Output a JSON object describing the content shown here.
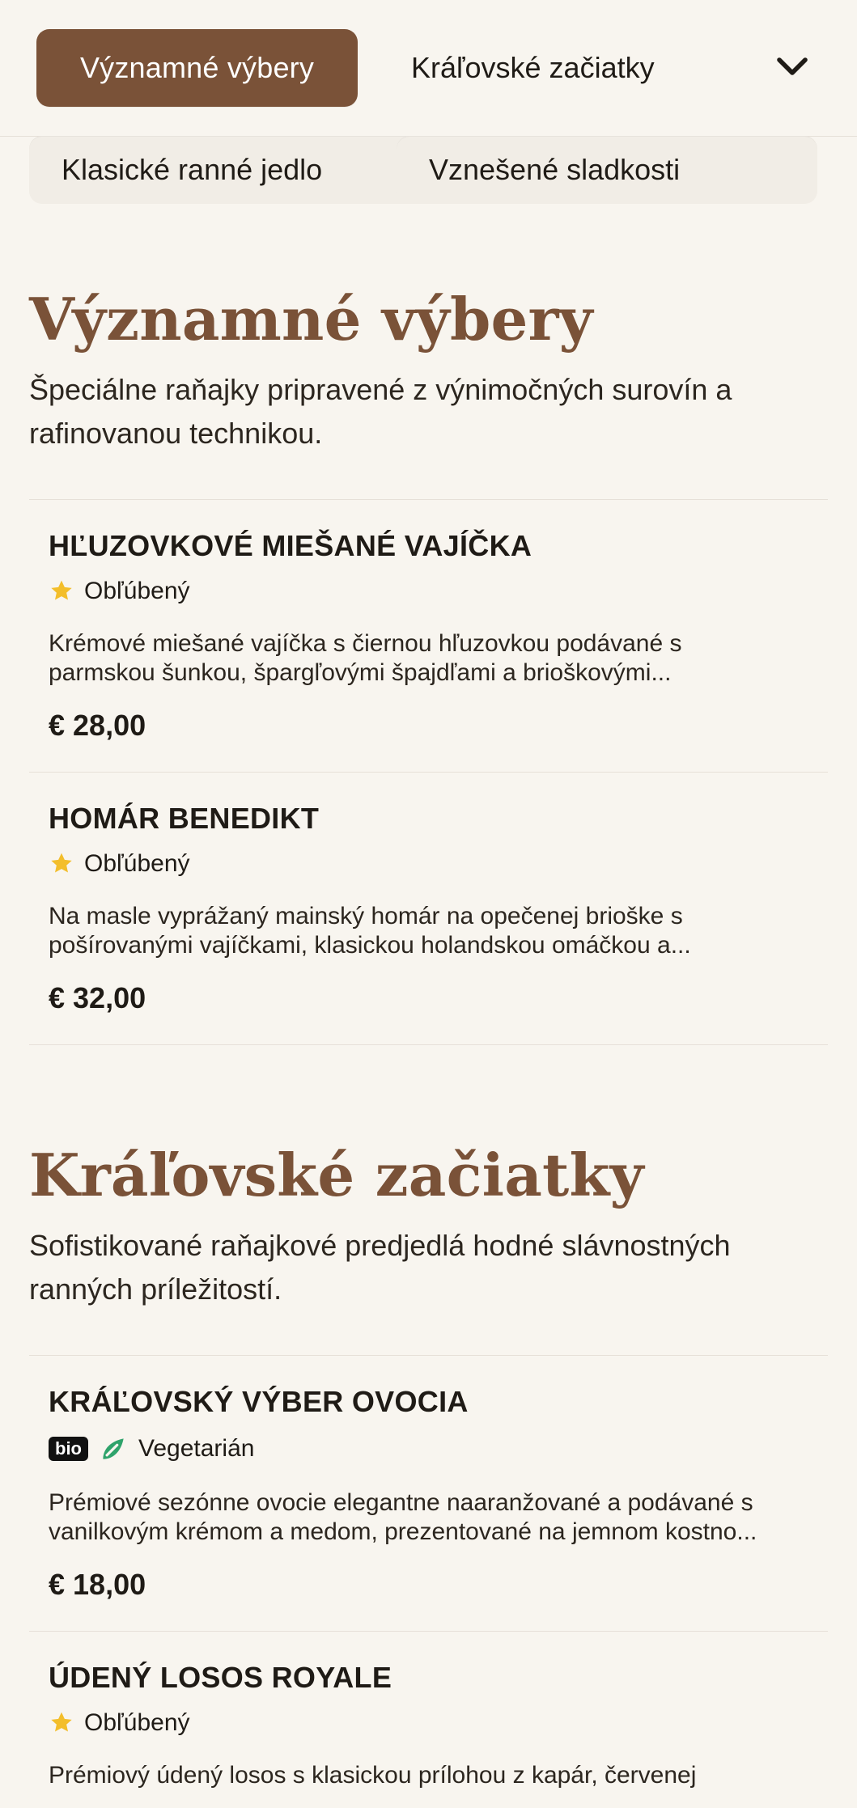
{
  "nav": {
    "active_tab": "Významné výbery",
    "second_tab": "Kráľovské začiatky",
    "chips": [
      "Klasické ranné jedlo",
      "Vznešené sladkosti"
    ],
    "dropdown_icon": "chevron-down-icon"
  },
  "sections": [
    {
      "title": "Významné výbery",
      "description": "Špeciálne raňajky pripravené z výnimočných surovín a rafinovanou technikou.",
      "items": [
        {
          "name": "HĽUZOVKOVÉ MIEŠANÉ VAJÍČKA",
          "badge": "Obľúbený",
          "desc_lines": [
            "Krémové miešané vajíčka s čiernou hľuzovkou podávané s",
            "parmskou šunkou, špargľovými špajdľami a brioškovými..."
          ],
          "price": "€ 28,00"
        },
        {
          "name": "HOMÁR BENEDIKT",
          "badge": "Obľúbený",
          "desc_lines": [
            "Na masle vyprážaný mainský homár na opečenej brioške s",
            "pošírovanými vajíčkami, klasickou holandskou omáčkou a..."
          ],
          "price": "€ 32,00"
        }
      ]
    },
    {
      "title": "Kráľovské začiatky",
      "description": "Sofistikované raňajkové predjedlá hodné slávnostných ranných príležitostí.",
      "items": [
        {
          "name": "KRÁĽOVSKÝ VÝBER OVOCIA",
          "bio": "bio",
          "badge": "Vegetarián",
          "desc_lines": [
            "Prémiové sezónne ovocie elegantne naaranžované a podávané s",
            "vanilkovým krémom a medom, prezentované na jemnom kostno..."
          ],
          "price": "€ 18,00"
        },
        {
          "name": "ÚDENÝ LOSOS ROYALE",
          "badge": "Obľúbený",
          "desc_lines": [
            "Prémiový údený losos s klasickou prílohou z kapár, červenej"
          ]
        }
      ]
    }
  ],
  "colors": {
    "accent": "#7a5238",
    "background": "#f8f5ef",
    "card": "#f1ede6",
    "star": "#f3be2b",
    "vegetarian": "#2fa36b"
  }
}
